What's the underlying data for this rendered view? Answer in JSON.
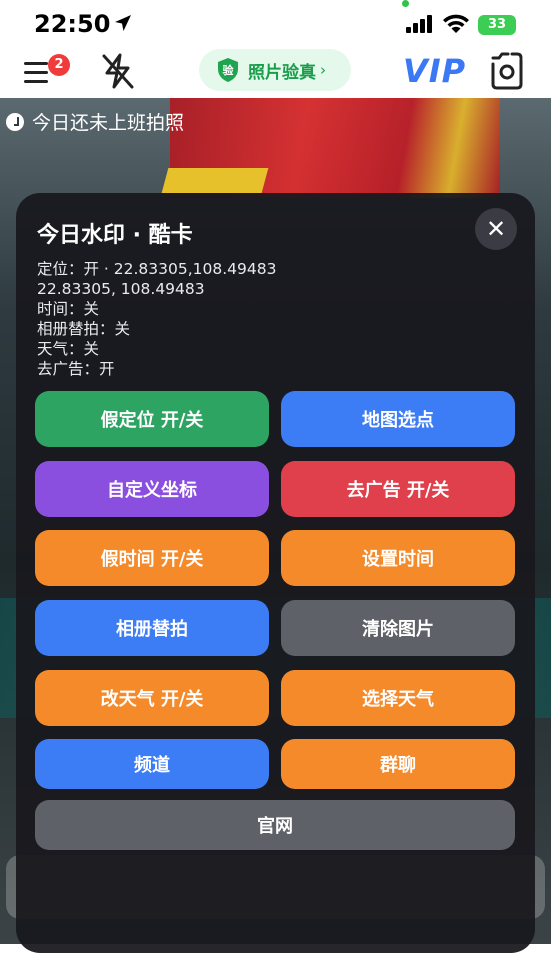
{
  "status_bar": {
    "time": "22:50",
    "battery": "33",
    "icons": [
      "location-arrow-icon",
      "signal-icon",
      "wifi-icon",
      "battery-charging-icon"
    ]
  },
  "top_nav": {
    "menu_badge": "2",
    "verify_label": "照片验真",
    "verify_chevron": "›",
    "vip_label": "VIP",
    "icons": [
      "menu-icon",
      "flash-off-icon",
      "shield-icon",
      "camera-flip-icon"
    ]
  },
  "camera": {
    "tag_text": "今日还未上班拍照"
  },
  "modal": {
    "title": "今日水印 · 酷卡",
    "close_symbol": "✕",
    "info_lines": [
      "定位：开 · 22.83305,108.49483",
      "22.83305, 108.49483",
      "时间：关",
      "相册替拍：关",
      "天气：关",
      "去广告：开"
    ],
    "buttons": {
      "fake_location": "假定位 开/关",
      "map_pick": "地图选点",
      "custom_coords": "自定义坐标",
      "remove_ads": "去广告 开/关",
      "fake_time": "假时间 开/关",
      "set_time": "设置时间",
      "album_photo": "相册替拍",
      "clear_image": "清除图片",
      "change_weather": "改天气 开/关",
      "choose_weather": "选择天气",
      "channel": "频道",
      "group_chat": "群聊",
      "official_site": "官网"
    },
    "colors": {
      "green": "#2ea463",
      "blue": "#3c7cf4",
      "purple": "#8b4fe0",
      "red": "#e0404c",
      "orange": "#f58a2b",
      "gray": "#5f6168"
    }
  }
}
